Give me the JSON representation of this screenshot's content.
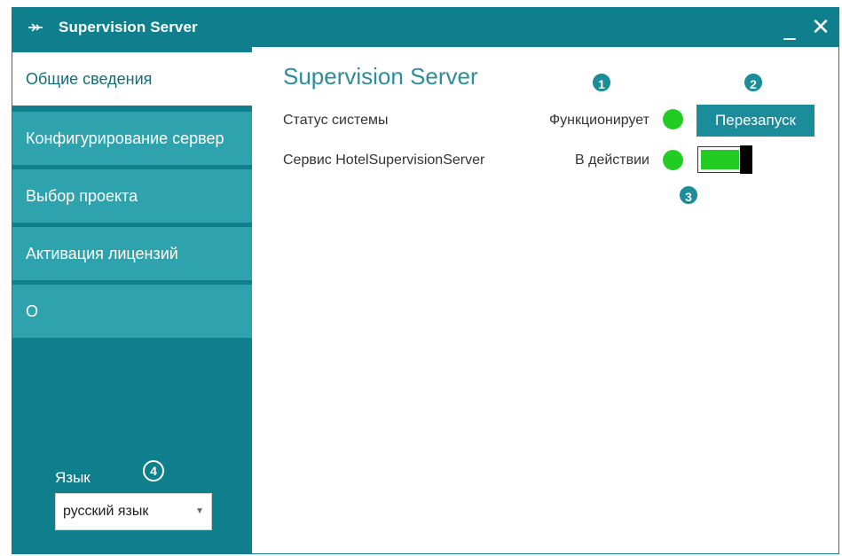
{
  "window": {
    "title": "Supervision Server",
    "minimize_label": "_",
    "close_label": "✕"
  },
  "sidebar": {
    "items": [
      {
        "label": "Общие сведения",
        "active": true
      },
      {
        "label": "Конфигурирование сервер",
        "active": false
      },
      {
        "label": "Выбор проекта",
        "active": false
      },
      {
        "label": "Активация лицензий",
        "active": false
      },
      {
        "label": "О",
        "active": false
      }
    ],
    "language_label": "Язык",
    "language_value": "русский язык"
  },
  "main": {
    "title": "Supervision Server",
    "rows": [
      {
        "label": "Статус системы",
        "value": "Функционирует",
        "status_color": "#22cc22"
      },
      {
        "label": "Сервис HotelSupervisionServer",
        "value": "В действии",
        "status_color": "#22cc22"
      }
    ],
    "restart_label": "Перезапуск",
    "service_toggle_on": true
  },
  "callouts": [
    "1",
    "2",
    "3",
    "4"
  ],
  "colors": {
    "accent": "#0f7f8d",
    "nav_item": "#2ea2ad",
    "status_ok": "#22cc22"
  }
}
